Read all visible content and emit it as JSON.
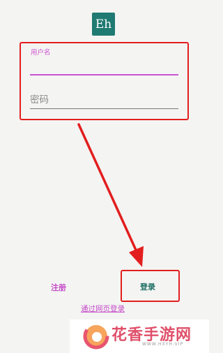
{
  "app": {
    "logo_text": "Eh",
    "logo_color": "#1f7a72"
  },
  "form": {
    "username_label": "用户名",
    "username_value": "",
    "password_placeholder": "密码",
    "password_value": ""
  },
  "actions": {
    "register_label": "注册",
    "login_label": "登录",
    "web_login_label": "通过网页登录"
  },
  "watermark": {
    "name": "花香手游网",
    "url": "WWW.HXYH.VIP"
  },
  "colors": {
    "accent": "#c44ac8",
    "login_text": "#1c6e63",
    "highlight": "#e21e1e",
    "background": "#f4f4f2"
  }
}
